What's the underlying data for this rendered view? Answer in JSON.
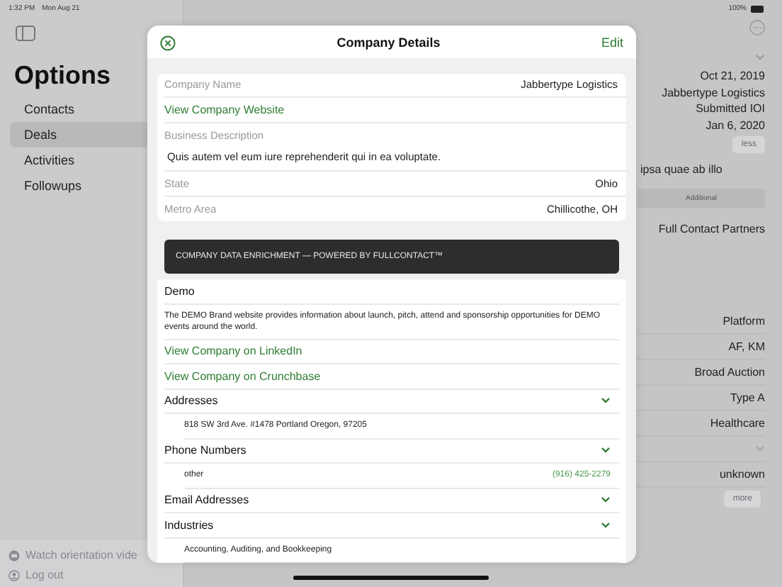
{
  "status_bar": {
    "time": "1:32 PM",
    "date": "Mon Aug 21",
    "battery": "100%"
  },
  "sidebar": {
    "title": "Options",
    "items": [
      {
        "label": "Contacts",
        "selected": false
      },
      {
        "label": "Deals",
        "selected": true
      },
      {
        "label": "Activities",
        "selected": false
      },
      {
        "label": "Followups",
        "selected": false
      }
    ],
    "footer_links": [
      {
        "label": "Watch orientation vide",
        "kind": "video"
      },
      {
        "label": "Log out",
        "kind": "user"
      }
    ]
  },
  "detail": {
    "values": [
      "Oct 21, 2019",
      "Jabbertype Logistics",
      "Submitted IOI",
      "Jan 6, 2020"
    ],
    "less_button": "less",
    "description": "ipsa quae ab illo",
    "segment": "Additional",
    "partner": "Full Contact Partners",
    "attributes": [
      {
        "kind": "text",
        "value": "Platform"
      },
      {
        "kind": "text",
        "value": "AF, KM"
      },
      {
        "kind": "text",
        "value": "Broad Auction"
      },
      {
        "kind": "text",
        "value": "Type A"
      },
      {
        "kind": "text",
        "value": "Healthcare"
      },
      {
        "kind": "chevron"
      },
      {
        "kind": "text",
        "value": "unknown"
      }
    ],
    "more_button": "more"
  },
  "modal": {
    "title": "Company Details",
    "edit": "Edit",
    "rows": [
      {
        "kind": "field",
        "label": "Company Name",
        "value": "Jabbertype Logistics"
      },
      {
        "kind": "link",
        "label": "View Company Website"
      },
      {
        "kind": "description",
        "label": "Business Description",
        "value": "Quis autem vel eum iure reprehenderit qui in ea voluptate."
      },
      {
        "kind": "field",
        "label": "State",
        "value": "Ohio"
      },
      {
        "kind": "field",
        "label": "Metro Area",
        "value": "Chillicothe, OH"
      }
    ],
    "banner": "COMPANY DATA ENRICHMENT — POWERED BY FULLCONTACT™",
    "enrichment": {
      "name": "Demo",
      "description": "The DEMO Brand website provides information about launch, pitch, attend and sponsorship opportunities for DEMO events around the world.",
      "links": [
        "View Company on LinkedIn",
        "View Company on Crunchbase"
      ],
      "sections": [
        {
          "title": "Addresses",
          "items": [
            {
              "label": "818 SW 3rd Ave. #1478  Portland Oregon, 97205"
            }
          ]
        },
        {
          "title": "Phone Numbers",
          "items": [
            {
              "label": "other",
              "value": "(916) 425-2279"
            }
          ]
        },
        {
          "title": "Email Addresses"
        },
        {
          "title": "Industries",
          "items": [
            {
              "label": "Accounting, Auditing, and Bookkeeping"
            }
          ]
        }
      ]
    }
  }
}
